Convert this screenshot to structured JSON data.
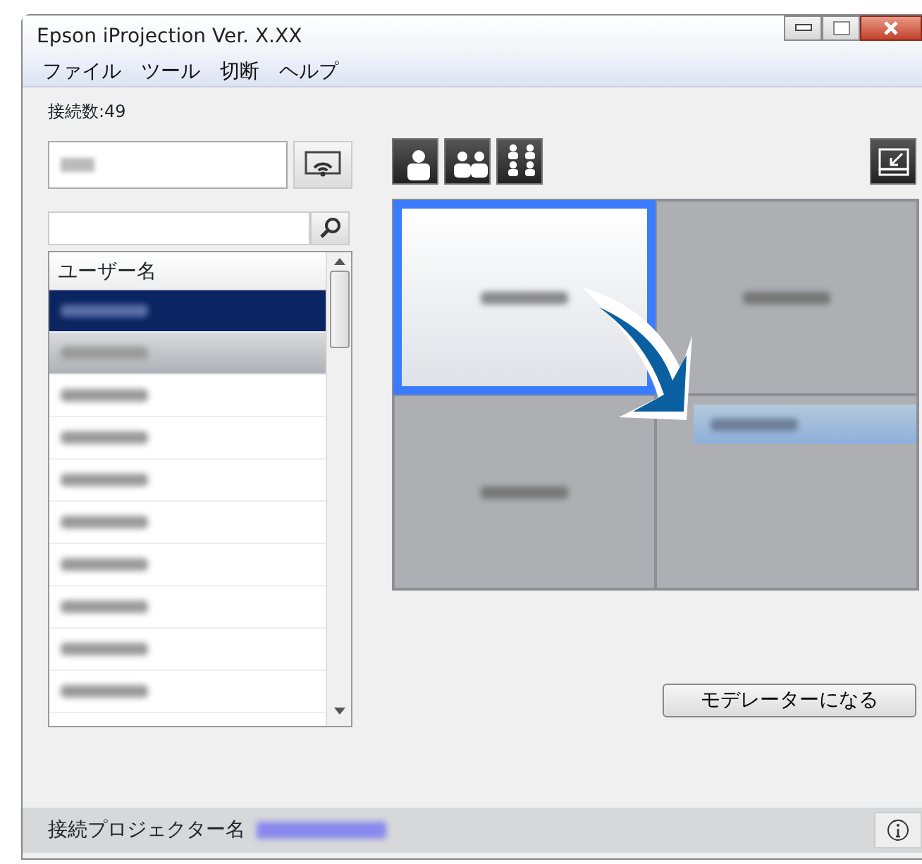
{
  "window": {
    "title": "Epson iProjection Ver. X.XX"
  },
  "menu": [
    "ファイル",
    "ツール",
    "切断",
    "ヘルプ"
  ],
  "connection_count": "接続数:49",
  "user_list": {
    "header": "ユーザー名",
    "rows": [
      {
        "selected": true,
        "dragging": false
      },
      {
        "selected": false,
        "dragging": true
      },
      {
        "selected": false,
        "dragging": false
      },
      {
        "selected": false,
        "dragging": false
      },
      {
        "selected": false,
        "dragging": false
      },
      {
        "selected": false,
        "dragging": false
      },
      {
        "selected": false,
        "dragging": false
      },
      {
        "selected": false,
        "dragging": false
      },
      {
        "selected": false,
        "dragging": false
      },
      {
        "selected": false,
        "dragging": false
      }
    ]
  },
  "layout_buttons": [
    {
      "kind": "one"
    },
    {
      "kind": "two"
    },
    {
      "kind": "four"
    }
  ],
  "quadrants": [
    {
      "selected": true,
      "occupied": true,
      "drop_preview": false
    },
    {
      "selected": false,
      "occupied": true,
      "drop_preview": false
    },
    {
      "selected": false,
      "occupied": true,
      "drop_preview": false
    },
    {
      "selected": false,
      "occupied": false,
      "drop_preview": true
    }
  ],
  "moderator_button": "モデレーターになる",
  "status_bar": {
    "label": "接続プロジェクター名"
  }
}
